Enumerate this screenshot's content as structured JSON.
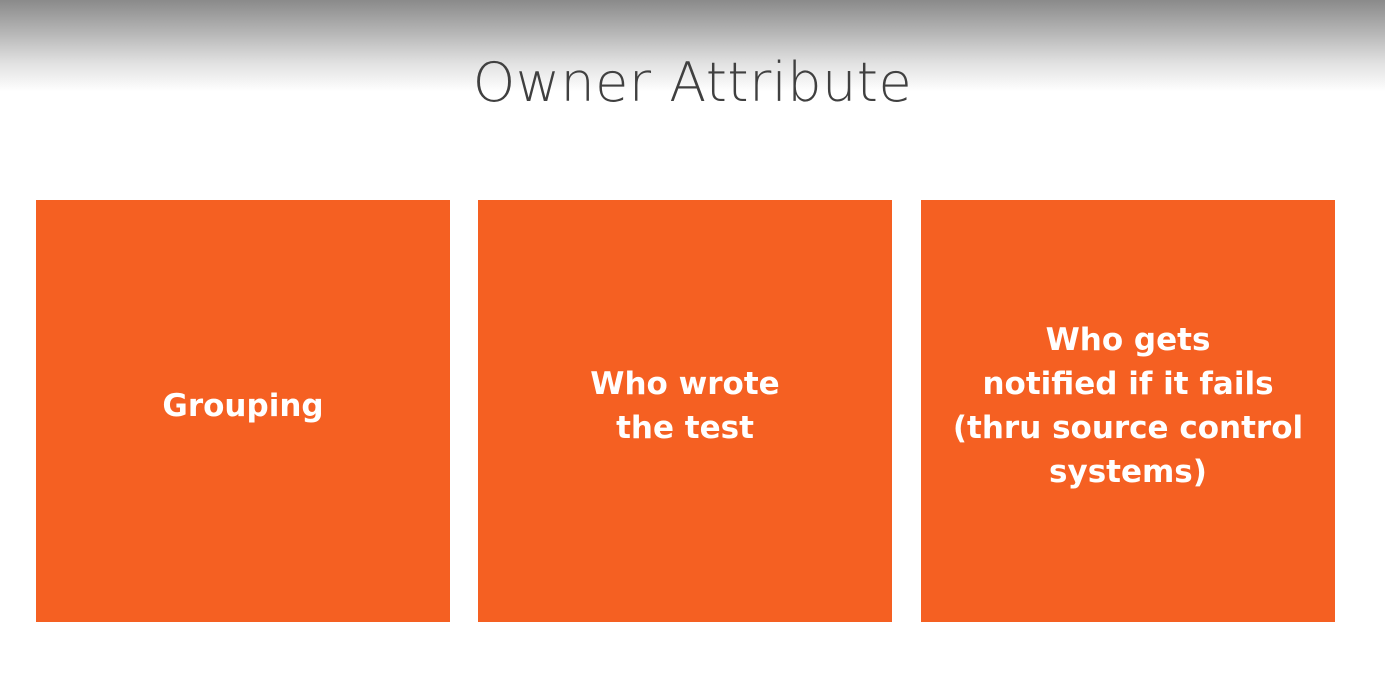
{
  "slide": {
    "title": "Owner Attribute",
    "cards": [
      {
        "label": "Grouping"
      },
      {
        "label": "Who wrote\nthe test"
      },
      {
        "label": "Who gets\nnotified if it fails\n(thru source control\nsystems)"
      }
    ]
  },
  "colors": {
    "card_background": "#f56022",
    "card_text": "#ffffff",
    "title_text": "#404040"
  }
}
